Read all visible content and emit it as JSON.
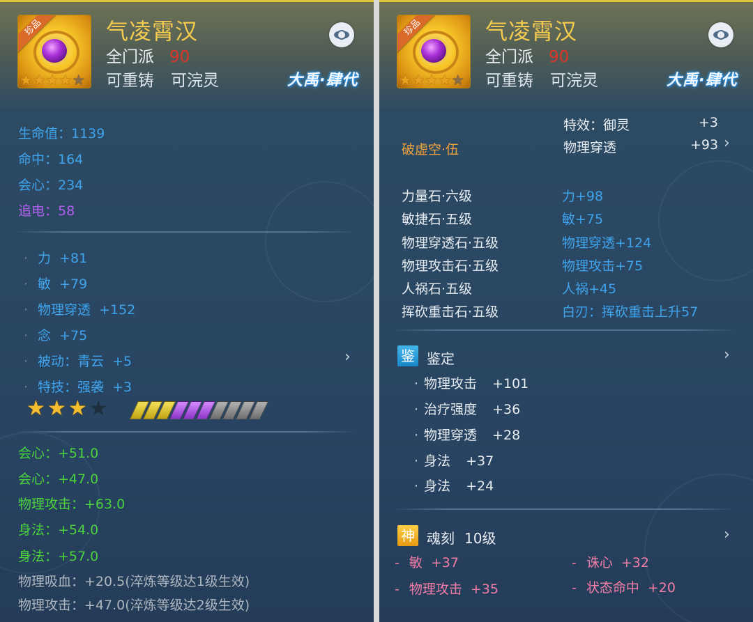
{
  "item": {
    "rarity_tag": "珍品",
    "name": "气凌霄汉",
    "faction": "全门派",
    "level": "90",
    "reforgeable": "可重铸",
    "washable": "可浣灵",
    "brand": "大禹·肆代",
    "icon_stars_filled": 4,
    "icon_stars_total": 5
  },
  "left": {
    "base_stats": [
      {
        "text": "生命值：1139",
        "color": "blue"
      },
      {
        "text": "命中：164",
        "color": "blue"
      },
      {
        "text": "会心：234",
        "color": "blue"
      },
      {
        "text": "追电：58",
        "color": "purple"
      }
    ],
    "attrs": [
      {
        "label": "力",
        "value": "+81"
      },
      {
        "label": "敏",
        "value": "+79"
      },
      {
        "label": "物理穿透",
        "value": "+152"
      },
      {
        "label": "念",
        "value": "+75"
      },
      {
        "label": "被动：青云",
        "value": "+5"
      },
      {
        "label": "特技：强袭",
        "value": "+3"
      }
    ],
    "stars_filled": 3,
    "stars_total": 4,
    "refine_bars": {
      "yellow": 3,
      "purple": 3,
      "grey": 4
    },
    "extra_stats": [
      {
        "text": "会心：+51.0",
        "color": "green"
      },
      {
        "text": "会心：+47.0",
        "color": "green"
      },
      {
        "text": "物理攻击：+63.0",
        "color": "green"
      },
      {
        "text": "身法：+54.0",
        "color": "green"
      },
      {
        "text": "身法：+57.0",
        "color": "green"
      },
      {
        "text": "物理吸血：+20.5(淬炼等级达1级生效)",
        "color": "grey"
      },
      {
        "text": "物理攻击：+47.0(淬炼等级达2级生效)",
        "color": "grey"
      }
    ]
  },
  "right": {
    "effect_label": "特效：御灵",
    "effect_value": "+3",
    "pierce_label": "物理穿透",
    "pierce_value": "+93",
    "set_name": "破虚空·伍",
    "gems": [
      {
        "name": "力量石·六级",
        "bonus": "力+98"
      },
      {
        "name": "敏捷石·五级",
        "bonus": "敏+75"
      },
      {
        "name": "物理穿透石·五级",
        "bonus": "物理穿透+124"
      },
      {
        "name": "物理攻击石·五级",
        "bonus": "物理攻击+75"
      },
      {
        "name": "人祸石·五级",
        "bonus": "人祸+45"
      },
      {
        "name": "挥砍重击石·五级",
        "bonus": "白刃：挥砍重击上升57"
      }
    ],
    "appraisal": {
      "badge": "鉴",
      "title": "鉴定",
      "items": [
        {
          "label": "物理攻击",
          "value": "+101"
        },
        {
          "label": "治疗强度",
          "value": "+36"
        },
        {
          "label": "物理穿透",
          "value": "+28"
        },
        {
          "label": "身法",
          "value": "+37"
        },
        {
          "label": "身法",
          "value": "+24"
        }
      ]
    },
    "soul": {
      "badge": "神",
      "title": "魂刻",
      "level": "10级",
      "items": [
        {
          "label": "敏",
          "value": "+37"
        },
        {
          "label": "诛心",
          "value": "+32"
        },
        {
          "label": "物理攻击",
          "value": "+35"
        },
        {
          "label": "状态命中",
          "value": "+20"
        }
      ]
    }
  },
  "colors": {
    "title": "#f4cb4e",
    "level": "#d9362b",
    "blue_stat": "#3fa4ec",
    "purple_stat": "#b25ff0",
    "green_stat": "#4bd23c",
    "gem_bonus": "#3fa4ec",
    "set_name": "#f0a23b",
    "soul_item": "#f27da6"
  }
}
